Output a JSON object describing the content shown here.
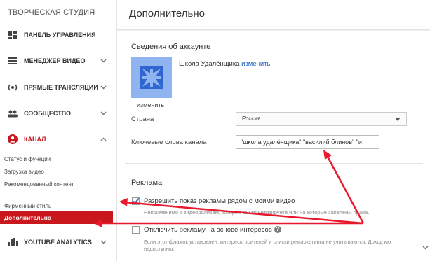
{
  "sidebar": {
    "title": "ТВОРЧЕСКАЯ СТУДИЯ",
    "items": [
      {
        "label": "ПАНЕЛЬ УПРАВЛЕНИЯ",
        "icon": "dashboard-icon"
      },
      {
        "label": "МЕНЕДЖЕР ВИДЕО",
        "icon": "video-manager-icon"
      },
      {
        "label": "ПРЯМЫЕ ТРАНСЛЯЦИИ",
        "icon": "live-icon"
      },
      {
        "label": "СООБЩЕСТВО",
        "icon": "community-icon"
      },
      {
        "label": "КАНАЛ",
        "icon": "channel-icon"
      },
      {
        "label": "YOUTUBE ANALYTICS",
        "icon": "analytics-icon"
      }
    ],
    "channel_sub": [
      "Статус и функции",
      "Загрузка видео",
      "Рекомендованный контент",
      "Фирменный стиль",
      "Дополнительно"
    ]
  },
  "main": {
    "title": "Дополнительно",
    "account": {
      "section_title": "Сведения об аккаунте",
      "channel_name": "Школа Удалёнщика",
      "change_link": "изменить",
      "avatar_change": "изменить",
      "country_label": "Страна",
      "country_value": "Россия",
      "keywords_label": "Ключевые слова канала",
      "keywords_value": "\"школа удалёнщика\" \"василий блинов\" \"и"
    },
    "ads": {
      "section_title": "Реклама",
      "allow_label": "Разрешить показ рекламы рядом с моими видео",
      "allow_checked": true,
      "allow_hint": "Неприменимо к видеороликам, которые вы монетизируете или на которые заявлены права.",
      "interest_label": "Отключить рекламу на основе интересов",
      "interest_checked": false,
      "interest_hint_1": "Если этот флажок установлен, интересы зрителей и списки ремаркетинга не учитываются. Доход мо",
      "interest_hint_2": "недоступны."
    }
  },
  "colors": {
    "accent": "#c9171e",
    "link": "#1a64c6",
    "avatar": "#8fb4ef",
    "arrow": "#e8192c"
  }
}
